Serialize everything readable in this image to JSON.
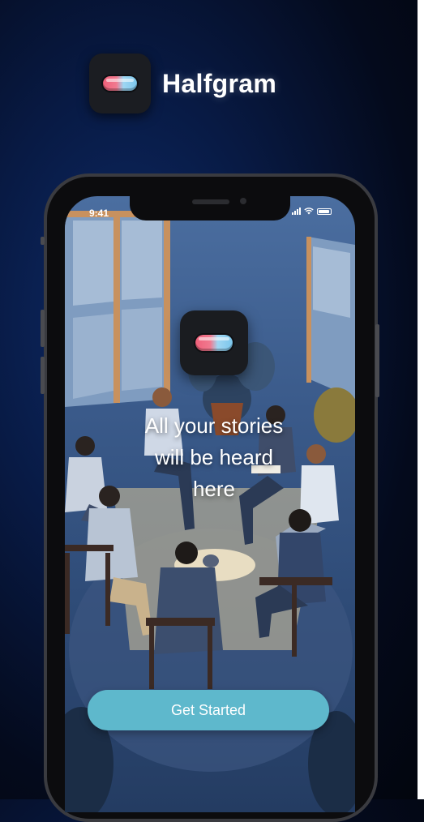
{
  "brand": {
    "name": "Halfgram",
    "icon": "pill-icon"
  },
  "status_bar": {
    "time": "9:41",
    "icons": [
      "signal-icon",
      "wifi-icon",
      "battery-icon"
    ]
  },
  "onboarding": {
    "icon": "pill-icon",
    "headline_lines": [
      "All your stories",
      "will be heard",
      "here"
    ],
    "cta_label": "Get Started"
  },
  "colors": {
    "cta": "#5eb8cc",
    "background": "#081a44",
    "pill_pink": "#f0607a",
    "pill_blue": "#7cc6ec"
  }
}
